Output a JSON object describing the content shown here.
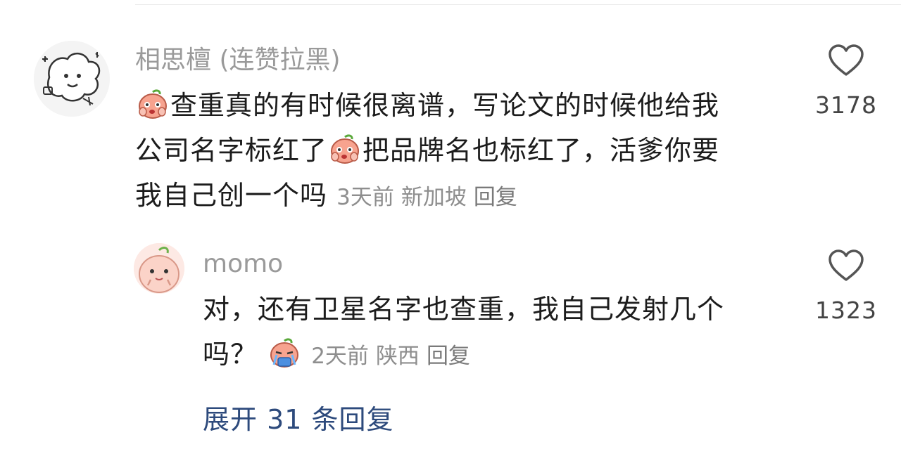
{
  "comments": [
    {
      "username": "相思檀 (连赞拉黑)",
      "avatar": "doodle-avatar",
      "text_line1": "查重真的有时候很离谱，写论文的时候他给我",
      "text_line2a": "公司名字标红了",
      "text_line2b": "把品牌名也标红了，活爹你要",
      "text_line3": "我自己创一个吗",
      "emoji": "peach-face-emoji",
      "time": "3天前",
      "location": "新加坡",
      "reply_label": "回复",
      "like_icon": "heart-outline-icon",
      "like_count": "3178"
    },
    {
      "username": "momo",
      "avatar": "peach-avatar",
      "text_line1": "对，还有卫星名字也查重，我自己发射几个",
      "text_line2": "吗？",
      "emoji": "peach-crying-emoji",
      "time": "2天前",
      "location": "陕西",
      "reply_label": "回复",
      "like_icon": "heart-outline-icon",
      "like_count": "1323"
    }
  ],
  "expand_replies": "展开 31 条回复",
  "colors": {
    "username": "#9a9a9a",
    "text": "#1c1c1c",
    "meta": "#8e8e8e",
    "link": "#2d4a7c",
    "heart": "#555555"
  }
}
